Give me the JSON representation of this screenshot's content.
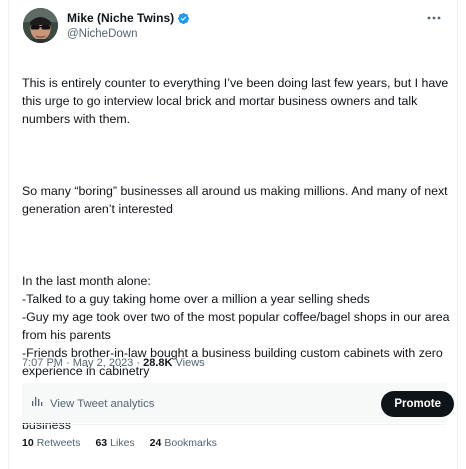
{
  "tweet": {
    "author": {
      "display_name": "Mike (Niche Twins)",
      "handle": "@NicheDown",
      "verified": true,
      "verified_color": "#1d9bf0"
    },
    "paragraphs": [
      "This is entirely counter to everything I’ve been doing last few years, but I have this urge to go interview local brick and mortar business owners and talk numbers with them.",
      "So many “boring” businesses all around us making millions. And many of next generation aren’t interested",
      "In the last month alone:\n-Talked to a guy taking home over a million a year selling sheds\n-Guy my age took over two of the most popular coffee/bagel shops in our area from his parents\n-Friends brother-in-law bought a business building custom cabinets with zero experience in cabinetry\n-Just went today to this kids play place. Just a rented space with kids toys everywhere. Place was packed. Would love you hear the numbers behind that business"
    ],
    "time": "7:07 PM",
    "date": "May 2, 2023",
    "views_count": "28.8K",
    "views_label": "Views",
    "separator": "·"
  },
  "analytics": {
    "link_label": "View Tweet analytics",
    "promote_label": "Promote"
  },
  "stats": {
    "retweets": {
      "count": "10",
      "label": "Retweets"
    },
    "likes": {
      "count": "63",
      "label": "Likes"
    },
    "bookmarks": {
      "count": "24",
      "label": "Bookmarks"
    }
  },
  "colors": {
    "text": "#0f1419",
    "secondary_text": "#536471",
    "analytics_bg": "#f7f9f9",
    "promote_bg": "#0f1419"
  },
  "icons": {
    "more": "more-horizontal-icon",
    "verified": "verified-badge-icon",
    "analytics": "bar-chart-icon"
  }
}
